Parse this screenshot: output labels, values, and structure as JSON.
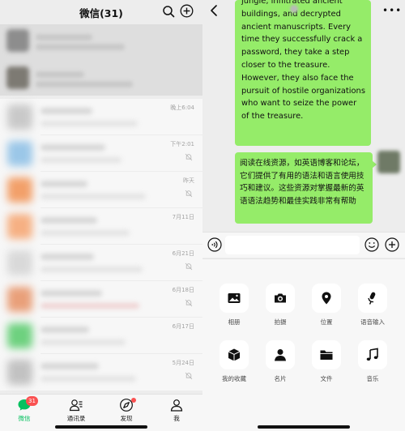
{
  "left": {
    "title": "微信(31)",
    "chats": [
      {
        "time": "晚上6:04",
        "muted": false,
        "avatar_color": "#c9c9c9"
      },
      {
        "time": "下午2:01",
        "muted": true,
        "avatar_color": "#9bc7e8"
      },
      {
        "time": "昨天",
        "muted": true,
        "avatar_color": "#f2a06a"
      },
      {
        "time": "7月11日",
        "muted": false,
        "avatar_color": "#f6b083"
      },
      {
        "time": "6月21日",
        "muted": true,
        "avatar_color": "#d9d9d9"
      },
      {
        "time": "6月18日",
        "muted": true,
        "avatar_color": "#e9a07a"
      },
      {
        "time": "6月17日",
        "muted": false,
        "avatar_color": "#6ed17f"
      },
      {
        "time": "5月24日",
        "muted": true,
        "avatar_color": "#c2c2c2"
      }
    ],
    "tabs": [
      {
        "label": "微信",
        "icon": "chat-icon",
        "badge": "31",
        "active": true
      },
      {
        "label": "通讯录",
        "icon": "contacts-icon",
        "active": false
      },
      {
        "label": "发现",
        "icon": "compass-icon",
        "active": false,
        "dot": true
      },
      {
        "label": "我",
        "icon": "person-icon",
        "active": false
      }
    ]
  },
  "right": {
    "messages": [
      {
        "text": "jungle, infiltrated ancient buildings, and decrypted ancient manuscripts. Every time they successfully crack a password, they take a step closer to the treasure. However, they also face the pursuit of hostile organizations who want to seize the power of the treasure."
      },
      {
        "text": "阅读在线资源，如英语博客和论坛，它们提供了有用的语法和语言使用技巧和建议。这些资源对掌握最新的英语语法趋势和最佳实践非常有帮助"
      }
    ],
    "tools": [
      {
        "label": "相册",
        "icon": "photo-icon"
      },
      {
        "label": "拍摄",
        "icon": "camera-icon"
      },
      {
        "label": "位置",
        "icon": "location-icon"
      },
      {
        "label": "语音输入",
        "icon": "microphone-icon"
      },
      {
        "label": "我的收藏",
        "icon": "favorites-cube-icon"
      },
      {
        "label": "名片",
        "icon": "contact-card-icon"
      },
      {
        "label": "文件",
        "icon": "folder-icon"
      },
      {
        "label": "音乐",
        "icon": "music-icon"
      }
    ],
    "colors": {
      "bubble": "#95ec69",
      "accent": "#07c160",
      "badge": "#fa5151"
    }
  }
}
